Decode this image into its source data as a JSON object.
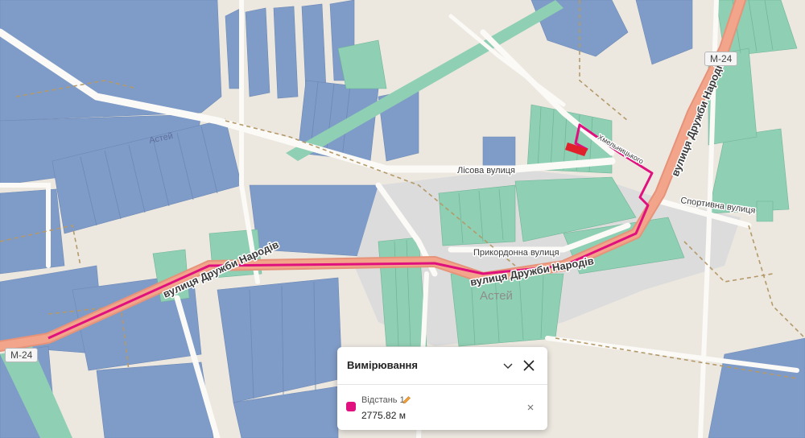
{
  "map": {
    "road_badges": [
      "M-24",
      "M-24"
    ],
    "street_labels": {
      "druzhby_narodiv_west": "вулиця Дружби Народів",
      "druzhby_narodiv_center": "вулиця Дружби Народів",
      "druzhby_narodiv_north": "вулиця Дружби Народів",
      "lisova": "Лісова вулиця",
      "prykordonna": "Прикордонна вулиця",
      "sportyvna": "Спортивна вулиця",
      "khmelnytskoho": "Хмельницького",
      "astei_village": "Астей",
      "astei_field": "Астей"
    },
    "colors": {
      "land": "#ece8e0",
      "parcel_blue": "#7f9bc7",
      "parcel_green": "#8fcfb3",
      "built_area": "#dcdcdc",
      "main_road": "#f2a58b",
      "minor_road": "#fbfaf7",
      "boundary": "#b49a6a",
      "measurement_line": "#e0117f",
      "target_parcel": "#e0202b"
    }
  },
  "measurement_panel": {
    "title": "Вимірювання",
    "collapse_icon": "chevron-down-icon",
    "close_icon": "close-icon",
    "items": [
      {
        "name": "Відстань 1",
        "edit_icon": "pencil-icon",
        "value": "2775.82 м",
        "color": "#e0117f",
        "remove_icon": "close-icon"
      }
    ]
  }
}
